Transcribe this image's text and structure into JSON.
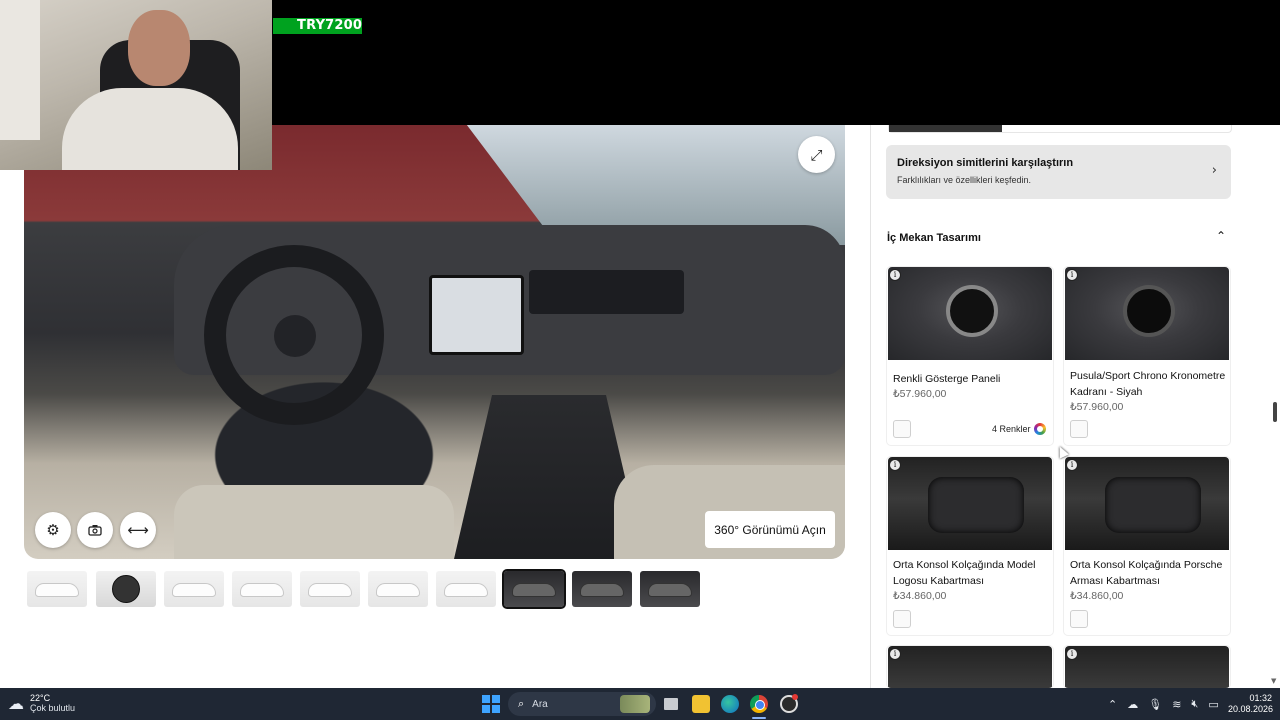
{
  "overlay": {
    "donation_badge": "TRY7200"
  },
  "viewer": {
    "btn_360_label": "360° Görünümü Açın",
    "icons": {
      "settings": "gear-icon",
      "camera": "camera-icon",
      "pan": "arrows-horizontal-icon",
      "fullscreen": "expand-icon"
    },
    "thumbnails": [
      {
        "view": "exterior-front-three-quarter",
        "dark": false
      },
      {
        "view": "wheel-closeup",
        "dark": false
      },
      {
        "view": "exterior-side",
        "dark": false
      },
      {
        "view": "exterior-rear-three-quarter",
        "dark": false
      },
      {
        "view": "exterior-top",
        "dark": false
      },
      {
        "view": "exterior-front",
        "dark": false
      },
      {
        "view": "exterior-rear",
        "dark": false
      },
      {
        "view": "interior-dashboard",
        "dark": true,
        "selected": true
      },
      {
        "view": "interior-seats",
        "dark": true
      },
      {
        "view": "interior-rear-seats",
        "dark": true
      }
    ]
  },
  "panel": {
    "compare": {
      "title": "Direksiyon simitlerini karşılaştırın",
      "subtitle": "Farklılıkları ve özellikleri keşfedin.",
      "chevron": "›"
    },
    "section_title": "İç Mekan Tasarımı",
    "section_toggle": "⌃",
    "options": [
      {
        "name": "Renkli Gösterge Paneli",
        "price": "₺57.960,00",
        "colors_label": "4 Renkler"
      },
      {
        "name": "Pusula/Sport Chrono Kronometre Kadranı - Siyah",
        "price": "₺57.960,00"
      },
      {
        "name": "Orta Konsol Kolçağında Model Logosu Kabartması",
        "price": "₺34.860,00"
      },
      {
        "name": "Orta Konsol Kolçağında Porsche Arması Kabartması",
        "price": "₺34.860,00"
      }
    ],
    "info_glyph": "i"
  },
  "taskbar": {
    "weather_temp": "22°C",
    "weather_desc": "Çok bulutlu",
    "search_label": "Ara",
    "clock_time": "01:32",
    "clock_date": "20.08.2026",
    "tray_icons": [
      "chevron-up-icon",
      "onedrive-icon",
      "microphone-icon",
      "wifi-icon",
      "volume-muted-icon",
      "battery-icon"
    ]
  }
}
